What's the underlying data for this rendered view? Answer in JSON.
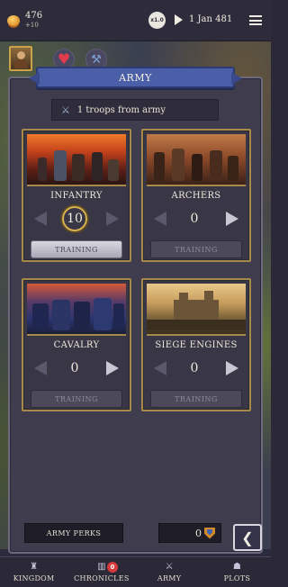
{
  "topbar": {
    "gold": "476",
    "gold_income": "+10",
    "speed": "x1.0",
    "date": "1 Jan 481"
  },
  "panel": {
    "title": "ARMY",
    "troops_text": "1 troops from army"
  },
  "cards": [
    {
      "name": "INFANTRY",
      "count": "10",
      "train_label": "TRAINING",
      "active": true
    },
    {
      "name": "ARCHERS",
      "count": "0",
      "train_label": "TRAINING",
      "active": false
    },
    {
      "name": "CAVALRY",
      "count": "0",
      "train_label": "TRAINING",
      "active": false
    },
    {
      "name": "SIEGE ENGINES",
      "count": "0",
      "train_label": "TRAINING",
      "active": false
    }
  ],
  "perks": {
    "label": "ARMY PERKS",
    "count": "0"
  },
  "nav": [
    {
      "label": "KINGDOM",
      "icon": "castle-icon"
    },
    {
      "label": "CHRONICLES",
      "icon": "book-icon",
      "badge": "0"
    },
    {
      "label": "ARMY",
      "icon": "swords-icon"
    },
    {
      "label": "PLOTS",
      "icon": "hood-icon"
    }
  ],
  "colors": {
    "banner": "#4a5fa8",
    "card_border": "#a78a4a",
    "badge": "#d63a3a"
  }
}
